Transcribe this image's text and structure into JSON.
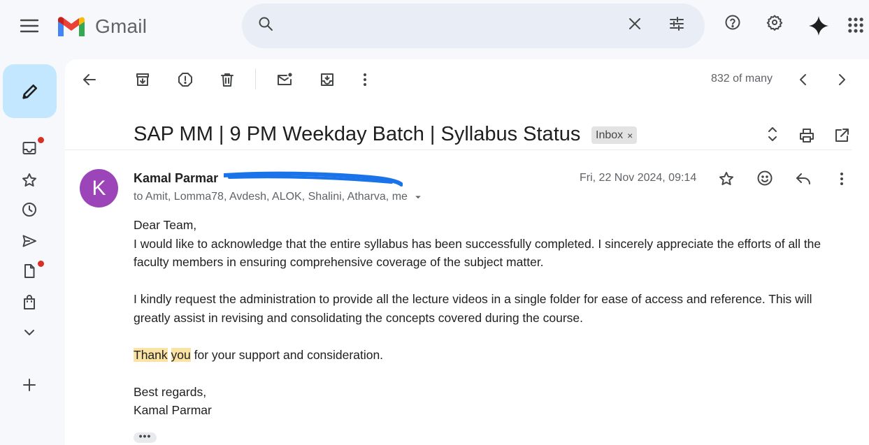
{
  "header": {
    "app_name": "Gmail",
    "search_placeholder": ""
  },
  "toolbar": {
    "count": "832 of many"
  },
  "email": {
    "subject": "SAP MM | 9 PM Weekday Batch | Syllabus Status",
    "label_chip": "Inbox",
    "sender_name": "Kamal Parmar",
    "recipients": "to Amit, Lomma78, Avdesh, ALOK, Shalini, Atharva, me",
    "date": "Fri, 22 Nov 2024, 09:14",
    "avatar_initial": "K",
    "body": {
      "greeting": "Dear Team,",
      "para1": "I would like to acknowledge that the entire syllabus has been successfully completed. I sincerely appreciate the efforts of all the faculty members in ensuring comprehensive coverage of the subject matter.",
      "para2": "I kindly request the administration to provide all the lecture videos in a single folder for ease of access and reference. This will greatly assist in revising and consolidating the concepts covered during the course.",
      "thanks_word1": "Thank",
      "thanks_word2": "you",
      "thanks_rest": " for your support and consideration.",
      "signoff": "Best regards,",
      "signature": "Kamal Parmar"
    }
  },
  "colors": {
    "accent_compose": "#c2e7ff",
    "avatar_bg": "#9c45b8",
    "highlight": "#fbe3a4",
    "notification_dot": "#d93025",
    "redaction_ink": "#1a73e8"
  },
  "icons": {
    "header": [
      "menu-icon",
      "gmail-logo",
      "search-icon",
      "close-icon",
      "tune-icon",
      "help-icon",
      "settings-icon",
      "gemini-spark-icon",
      "apps-grid-icon"
    ],
    "rail": [
      "pencil-icon",
      "inbox-icon",
      "star-icon",
      "clock-icon",
      "send-icon",
      "draft-icon",
      "bag-icon",
      "chevron-down-icon",
      "plus-icon"
    ],
    "toolbar": [
      "back-arrow-icon",
      "archive-icon",
      "report-spam-icon",
      "delete-icon",
      "mark-unread-icon",
      "move-to-icon",
      "more-vert-icon",
      "chevron-left-icon",
      "chevron-right-icon"
    ],
    "message": [
      "expand-collapse-icon",
      "print-icon",
      "open-new-window-icon",
      "star-icon",
      "emoji-icon",
      "reply-icon",
      "more-vert-icon"
    ]
  }
}
